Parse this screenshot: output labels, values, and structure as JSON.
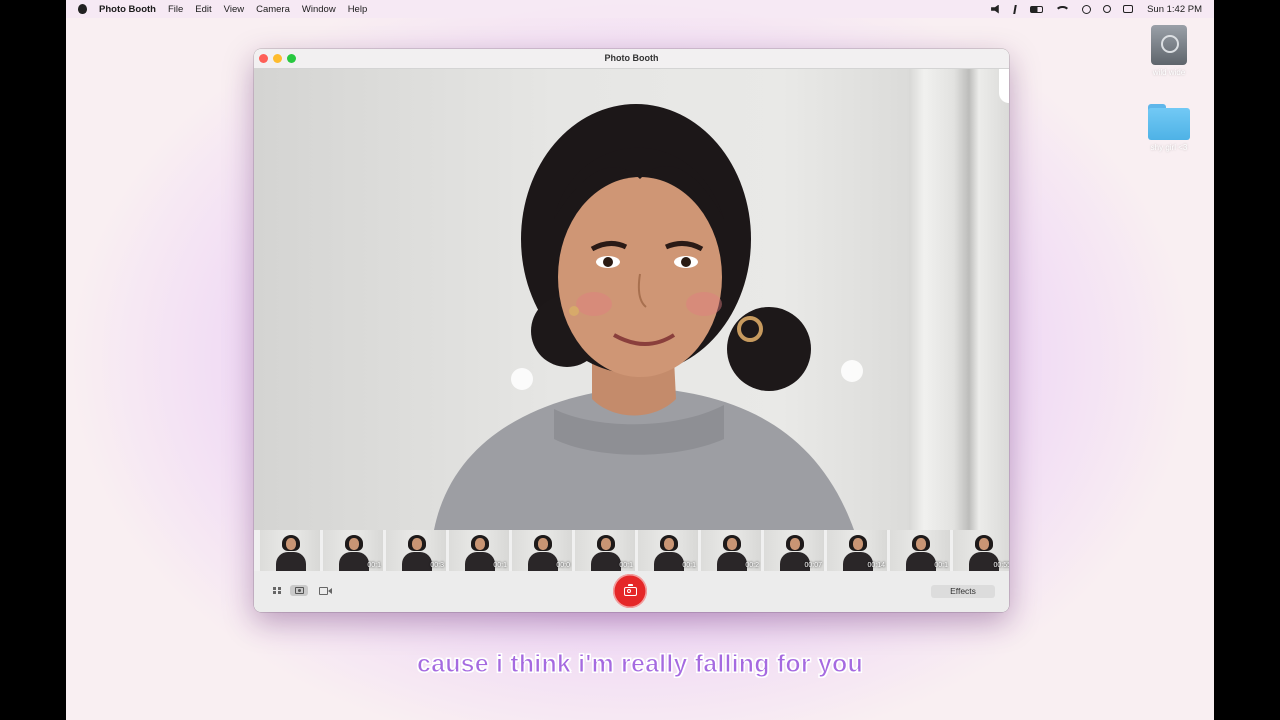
{
  "menubar": {
    "app_name": "Photo Booth",
    "items": [
      "File",
      "Edit",
      "View",
      "Camera",
      "Window",
      "Help"
    ],
    "clock": "Sun 1:42 PM"
  },
  "desktop": {
    "icons": [
      {
        "label": "wild wide",
        "icon": "hard-drive"
      },
      {
        "label": "shy girl <3",
        "icon": "folder"
      }
    ]
  },
  "window": {
    "title": "Photo Booth"
  },
  "filmstrip": {
    "thumbnails": [
      {
        "duration": ""
      },
      {
        "duration": "00:1"
      },
      {
        "duration": "00:3"
      },
      {
        "duration": "00:1"
      },
      {
        "duration": "00:0"
      },
      {
        "duration": "00:1"
      },
      {
        "duration": "00:1"
      },
      {
        "duration": "00:2"
      },
      {
        "duration": "00:07"
      },
      {
        "duration": "00:14"
      },
      {
        "duration": "00:1"
      },
      {
        "duration": "00:55"
      }
    ]
  },
  "toolbar": {
    "effects_label": "Effects",
    "shutter_icon": "camera-icon"
  },
  "caption": "cause i think i'm really falling for you",
  "colors": {
    "shutter": "#e52728",
    "caption": "#a56ae0",
    "background_glow": "#c46fe0"
  }
}
